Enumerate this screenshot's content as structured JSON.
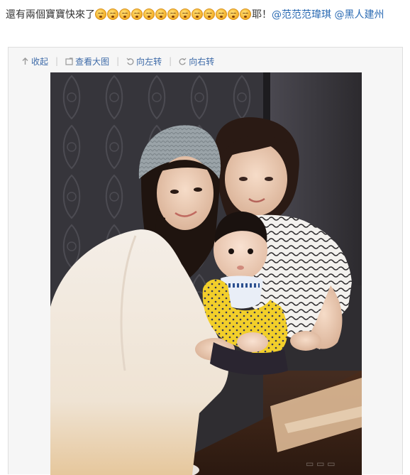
{
  "post": {
    "text_before": "還有兩個寶寶快來了",
    "emoji_name": "sleepy-face-icon",
    "emoji_count": 13,
    "text_after": "耶！",
    "mention_1": "@范范范瑋琪",
    "mention_2": "@黑人建州"
  },
  "toolbar": {
    "collapse_label": "收起",
    "view_large_label": "查看大图",
    "rotate_left_label": "向左转",
    "rotate_right_label": "向右转",
    "separator": "|"
  },
  "colors": {
    "link": "#2a6ab3",
    "text": "#333333",
    "card_bg": "#f6f6f6"
  }
}
